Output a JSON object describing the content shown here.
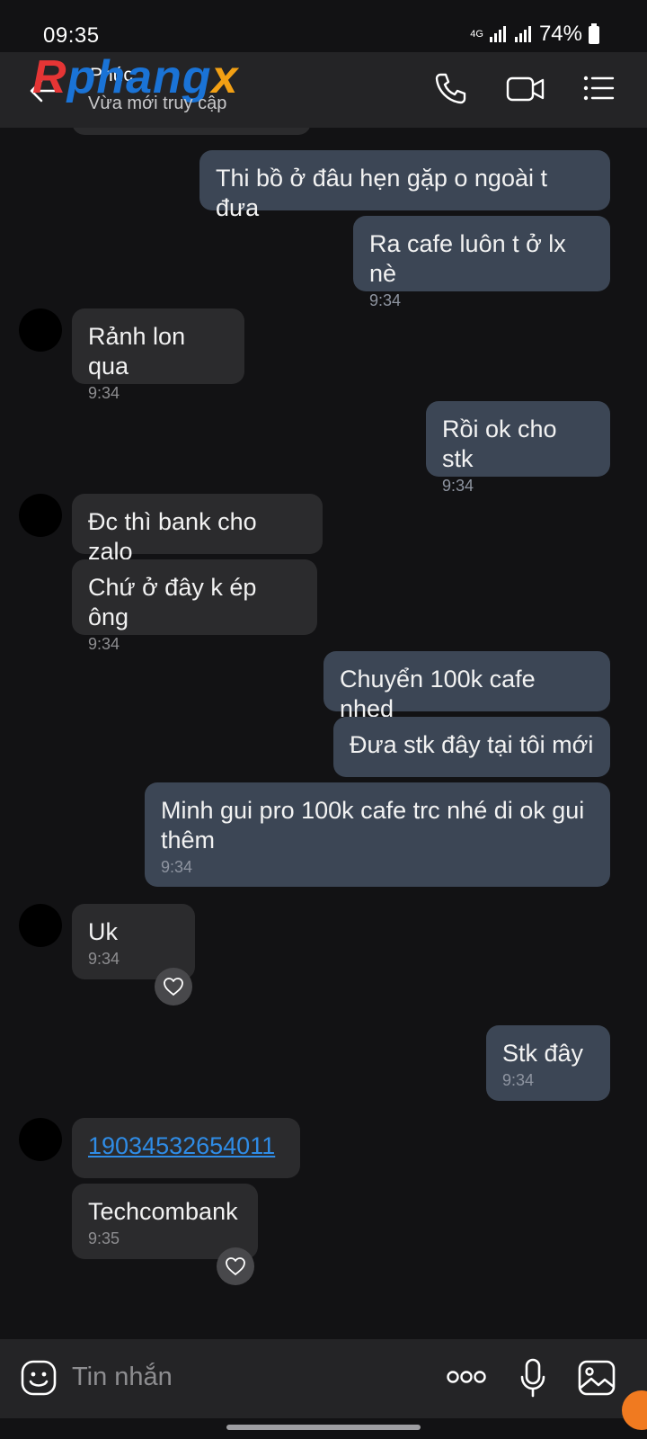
{
  "status_bar": {
    "time": "09:35",
    "network": "4G",
    "battery": "74%"
  },
  "header": {
    "contact_name": "Phúc",
    "contact_status": "Vừa mới truy cập",
    "watermark": {
      "r": "R",
      "middle": "phang",
      "x": "x"
    }
  },
  "messages": [
    {
      "dir": "out",
      "text": "Thi bồ ở đâu hẹn gặp o ngoài t đưa",
      "time": ""
    },
    {
      "dir": "out",
      "text": "Ra cafe luôn t ở lx nè",
      "time": "9:34"
    },
    {
      "dir": "in",
      "text": "Rảnh lon qua",
      "time": "9:34"
    },
    {
      "dir": "out",
      "text": "Rồi ok cho stk",
      "time": "9:34"
    },
    {
      "dir": "in",
      "text": "Đc thì bank cho zalo",
      "time": ""
    },
    {
      "dir": "in",
      "text": "Chứ ở đây k ép ông",
      "time": "9:34"
    },
    {
      "dir": "out",
      "text": "Chuyển 100k cafe nhed",
      "time": ""
    },
    {
      "dir": "out",
      "text": "Đưa stk đây tại tôi mới",
      "time": ""
    },
    {
      "dir": "out",
      "text": "Minh gui pro 100k cafe trc nhé di ok gui thêm",
      "time": "9:34"
    },
    {
      "dir": "in",
      "text": "Uk",
      "time": "9:34"
    },
    {
      "dir": "out",
      "text": "Stk đây",
      "time": "9:34"
    },
    {
      "dir": "in",
      "text": "19034532654011",
      "time": ""
    },
    {
      "dir": "in",
      "text": "Techcombank",
      "time": "9:35"
    }
  ],
  "input_bar": {
    "placeholder": "Tin nhắn",
    "more_label": "ooo"
  },
  "colors": {
    "background": "#121214",
    "header": "#242426",
    "outgoing_bubble": "#3c4655",
    "incoming_bubble": "#2b2b2d",
    "link": "#2f8ce6"
  }
}
